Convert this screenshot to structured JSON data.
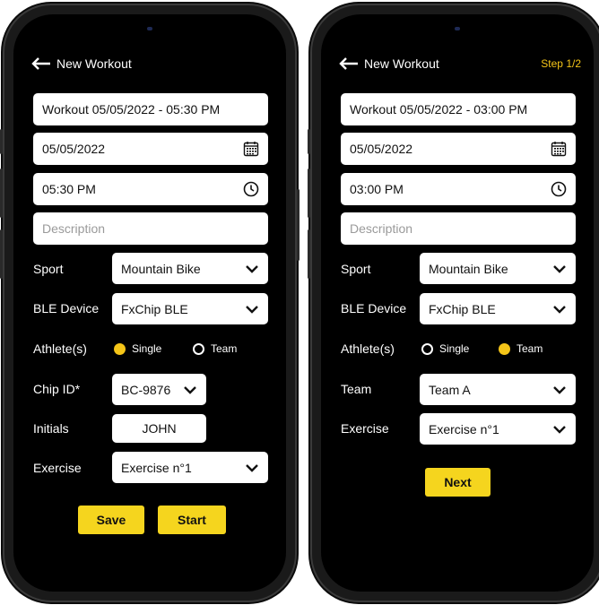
{
  "colors": {
    "accent": "#f5d51e",
    "radio_selected": "#f5c518",
    "background": "#000000",
    "field_background": "#ffffff",
    "placeholder": "#9a9a9a"
  },
  "icons": {
    "back": "arrow-left-icon",
    "date": "calendar-icon",
    "time": "clock-icon",
    "dropdown": "chevron-down-icon"
  },
  "left": {
    "header": {
      "title": "New Workout"
    },
    "workout_name": "Workout 05/05/2022 - 05:30 PM",
    "date": "05/05/2022",
    "time": "05:30 PM",
    "description_placeholder": "Description",
    "sport": {
      "label": "Sport",
      "value": "Mountain Bike"
    },
    "ble_device": {
      "label": "BLE Device",
      "value": "FxChip BLE"
    },
    "athletes": {
      "label": "Athlete(s)",
      "options": [
        "Single",
        "Team"
      ],
      "selected": "Single"
    },
    "chip_id": {
      "label": "Chip ID*",
      "value": "BC-9876"
    },
    "initials": {
      "label": "Initials",
      "value": "JOHN"
    },
    "exercise": {
      "label": "Exercise",
      "value": "Exercise n°1"
    },
    "buttons": {
      "save": "Save",
      "start": "Start"
    }
  },
  "right": {
    "header": {
      "title": "New Workout",
      "step": "Step 1/2"
    },
    "workout_name": "Workout 05/05/2022 - 03:00 PM",
    "date": "05/05/2022",
    "time": "03:00 PM",
    "description_placeholder": "Description",
    "sport": {
      "label": "Sport",
      "value": "Mountain Bike"
    },
    "ble_device": {
      "label": "BLE Device",
      "value": "FxChip BLE"
    },
    "athletes": {
      "label": "Athlete(s)",
      "options": [
        "Single",
        "Team"
      ],
      "selected": "Team"
    },
    "team": {
      "label": "Team",
      "value": "Team A"
    },
    "exercise": {
      "label": "Exercise",
      "value": "Exercise n°1"
    },
    "buttons": {
      "next": "Next"
    }
  }
}
